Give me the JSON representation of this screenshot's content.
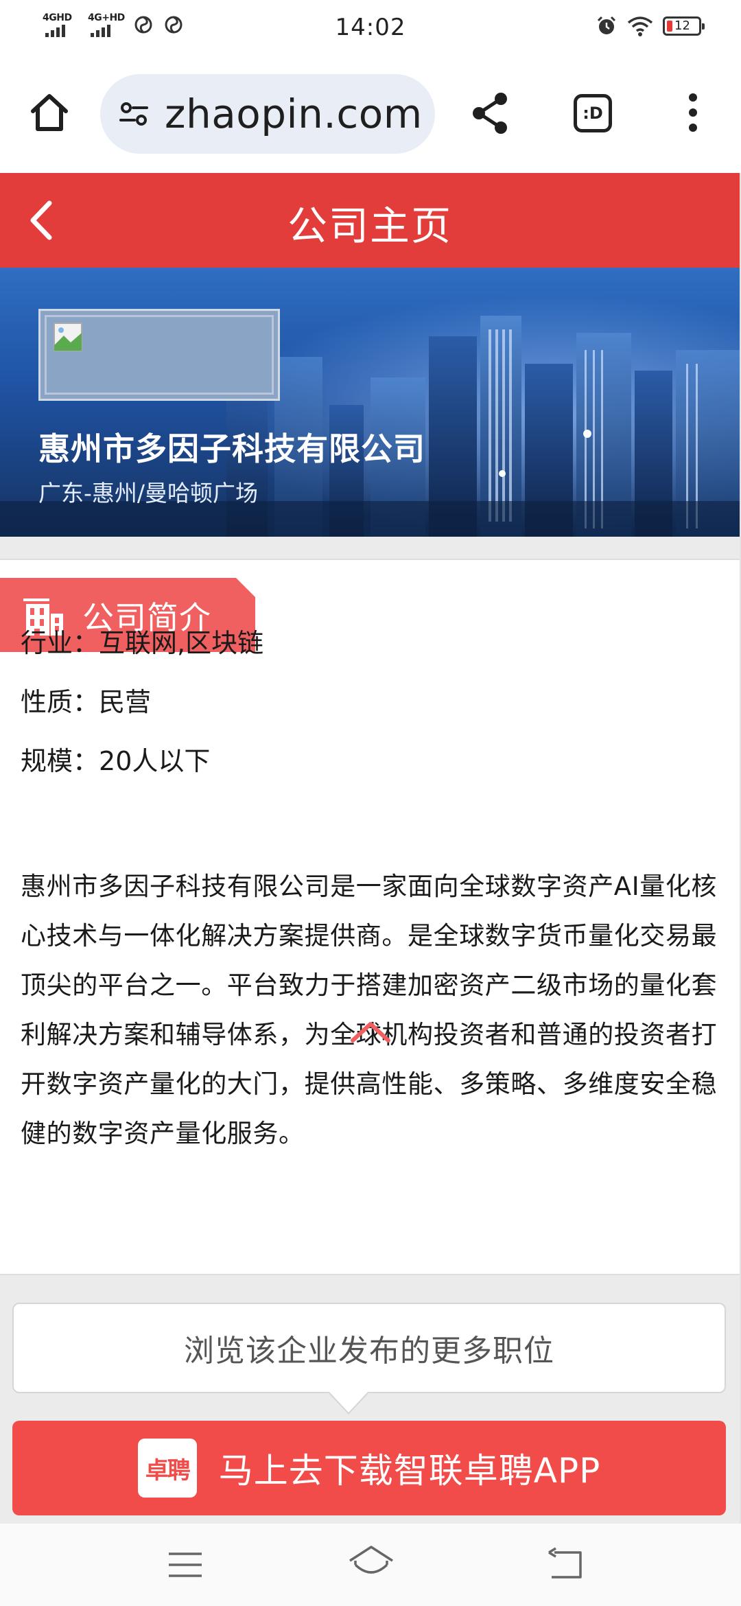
{
  "status_bar": {
    "time": "14:02",
    "network_1": "4GHD",
    "network_2": "4G+HD",
    "battery": "12",
    "icons": [
      "signal-icon",
      "swirl-icon",
      "alarm-icon",
      "wifi-icon",
      "battery-icon"
    ]
  },
  "browser": {
    "url": "zhaopin.com",
    "icons": [
      "home-icon",
      "site-settings-icon",
      "share-icon",
      "extension-icon",
      "more-menu-icon"
    ],
    "extension_label": ":D"
  },
  "header": {
    "title": "公司主页"
  },
  "company": {
    "name": "惠州市多因子科技有限公司",
    "location": "广东-惠州/曼哈顿广场"
  },
  "profile": {
    "section_title": "公司简介",
    "industry": {
      "label": "行业：",
      "value": "互联网,区块链"
    },
    "nature": {
      "label": "性质：",
      "value": "民营"
    },
    "size": {
      "label": "规模：",
      "value": "20人以下"
    },
    "description": "惠州市多因子科技有限公司是一家面向全球数字资产AI量化核心技术与一体化解决方案提供商。是全球数字货币量化交易最顶尖的平台之一。平台致力于搭建加密资产二级市场的量化套利解决方案和辅导体系，为全球机构投资者和普通的投资者打开数字资产量化的大门，提供高性能、多策略、多维度安全稳健的数字资产量化服务。"
  },
  "actions": {
    "more_jobs": "浏览该企业发布的更多职位",
    "download_app": "马上去下载智联卓聘APP",
    "app_logo_text": "卓聘"
  },
  "colors": {
    "brand_red": "#e33d3b",
    "tab_red": "#f06060",
    "button_red": "#f14c4a"
  }
}
